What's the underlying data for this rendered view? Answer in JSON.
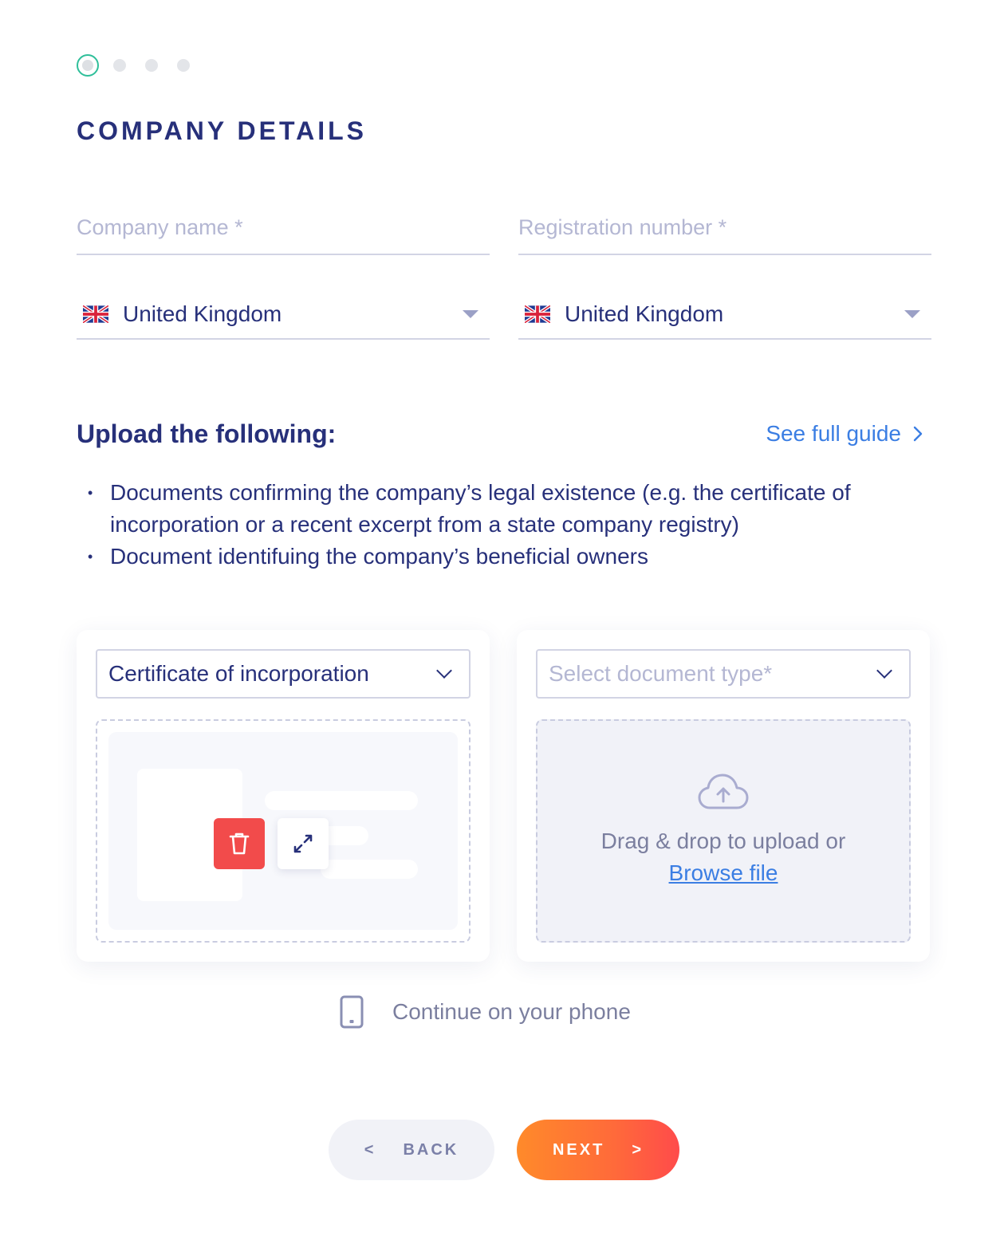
{
  "stepper": {
    "steps": 4,
    "active": 1
  },
  "page": {
    "title": "COMPANY DETAILS"
  },
  "form": {
    "company_name_placeholder": "Company name *",
    "registration_number_placeholder": "Registration number *",
    "country_left": "United Kingdom",
    "country_right": "United Kingdom"
  },
  "upload": {
    "heading": "Upload the following:",
    "guide_link": "See full guide",
    "bullets": [
      "Documents confirming the company’s legal existence (e.g. the certificate of incorporation or a recent excerpt from a state company registry)",
      "Document identifuing the company’s beneficial owners"
    ],
    "card_left": {
      "document_type": "Certificate of incorporation"
    },
    "card_right": {
      "document_type_placeholder": "Select document type*",
      "drop_text": "Drag & drop to upload or",
      "browse_label": "Browse file"
    }
  },
  "phone": {
    "label": "Continue on your phone"
  },
  "nav": {
    "back_icon": "<",
    "back_label": "BACK",
    "next_label": "NEXT",
    "next_icon": ">"
  },
  "colors": {
    "primary_text": "#27307a",
    "accent_teal": "#2fbf9a",
    "link_blue": "#3b7ee3",
    "delete_red": "#f24b4b",
    "next_gradient_start": "#ff8a2a",
    "next_gradient_end": "#ff4b4b"
  },
  "icons": [
    "uk-flag-icon",
    "caret-down-icon",
    "chevron-right-icon",
    "chevron-down-icon",
    "trash-icon",
    "expand-icon",
    "cloud-upload-icon",
    "phone-icon"
  ]
}
